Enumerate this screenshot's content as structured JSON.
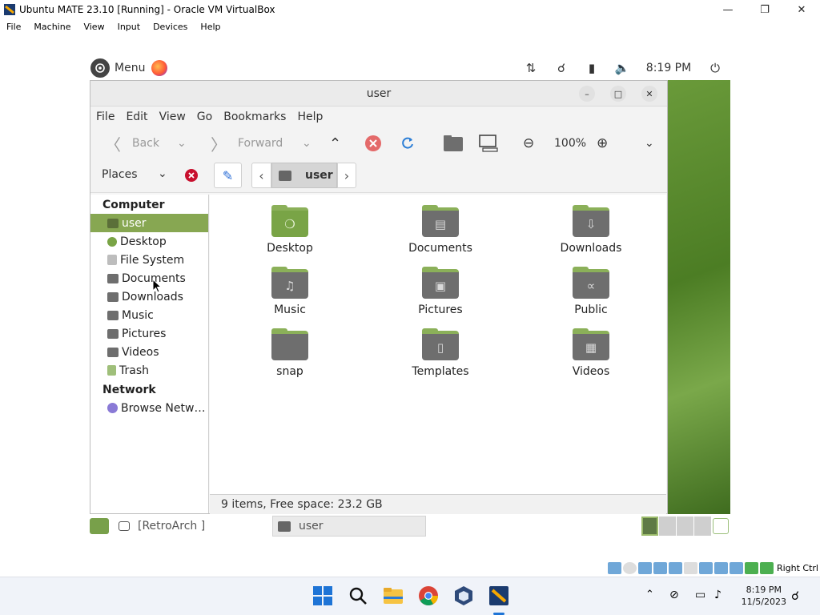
{
  "host": {
    "title": "Ubuntu MATE 23.10 [Running] - Oracle VM VirtualBox",
    "menu": [
      "File",
      "Machine",
      "View",
      "Input",
      "Devices",
      "Help"
    ],
    "status_host_key": "Right Ctrl"
  },
  "guest_panel": {
    "menu_label": "Menu",
    "clock": "8:19 PM"
  },
  "window": {
    "title": "user",
    "menu": [
      "File",
      "Edit",
      "View",
      "Go",
      "Bookmarks",
      "Help"
    ],
    "toolbar": {
      "back_label": "Back",
      "forward_label": "Forward",
      "zoom": "100%"
    },
    "places_label": "Places",
    "path_current": "user",
    "sidebar": {
      "computer_header": "Computer",
      "computer_items": [
        "user",
        "Desktop",
        "File System",
        "Documents",
        "Downloads",
        "Music",
        "Pictures",
        "Videos",
        "Trash"
      ],
      "network_header": "Network",
      "network_items": [
        "Browse Netw…"
      ]
    },
    "files": [
      "Desktop",
      "Documents",
      "Downloads",
      "Music",
      "Pictures",
      "Public",
      "snap",
      "Templates",
      "Videos"
    ],
    "status": "9 items, Free space: 23.2 GB"
  },
  "guest_bottom": {
    "task_retroarch": "[RetroArch ]",
    "task_user": "user"
  },
  "taskbar": {
    "time": "8:19 PM",
    "date": "11/5/2023"
  }
}
